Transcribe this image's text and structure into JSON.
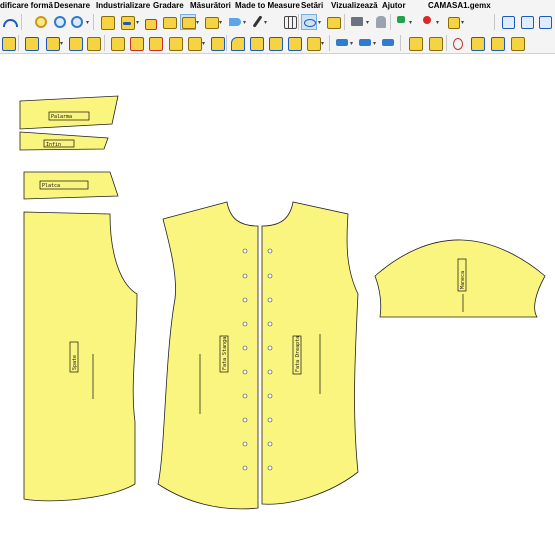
{
  "menu": {
    "items": [
      "dificare formă",
      "Desenare",
      "Industrializare",
      "Gradare",
      "Măsurători",
      "Made to Measure",
      "Setări",
      "Vizualizează",
      "Ajutor"
    ],
    "document_title": "CAMASA1.gemx"
  },
  "canvas": {
    "pieces": [
      {
        "label": "Palarma"
      },
      {
        "label": "Infin"
      },
      {
        "label": "Platca"
      },
      {
        "label": "Spate"
      },
      {
        "label": "Fata Stanga"
      },
      {
        "label": "Fata Dreapta"
      },
      {
        "label": "Maneca"
      }
    ]
  },
  "colors": {
    "piece_fill": "#faf57e",
    "toolbar_bg": "#f4f4f4",
    "canvas_bg": "#ffffff"
  }
}
